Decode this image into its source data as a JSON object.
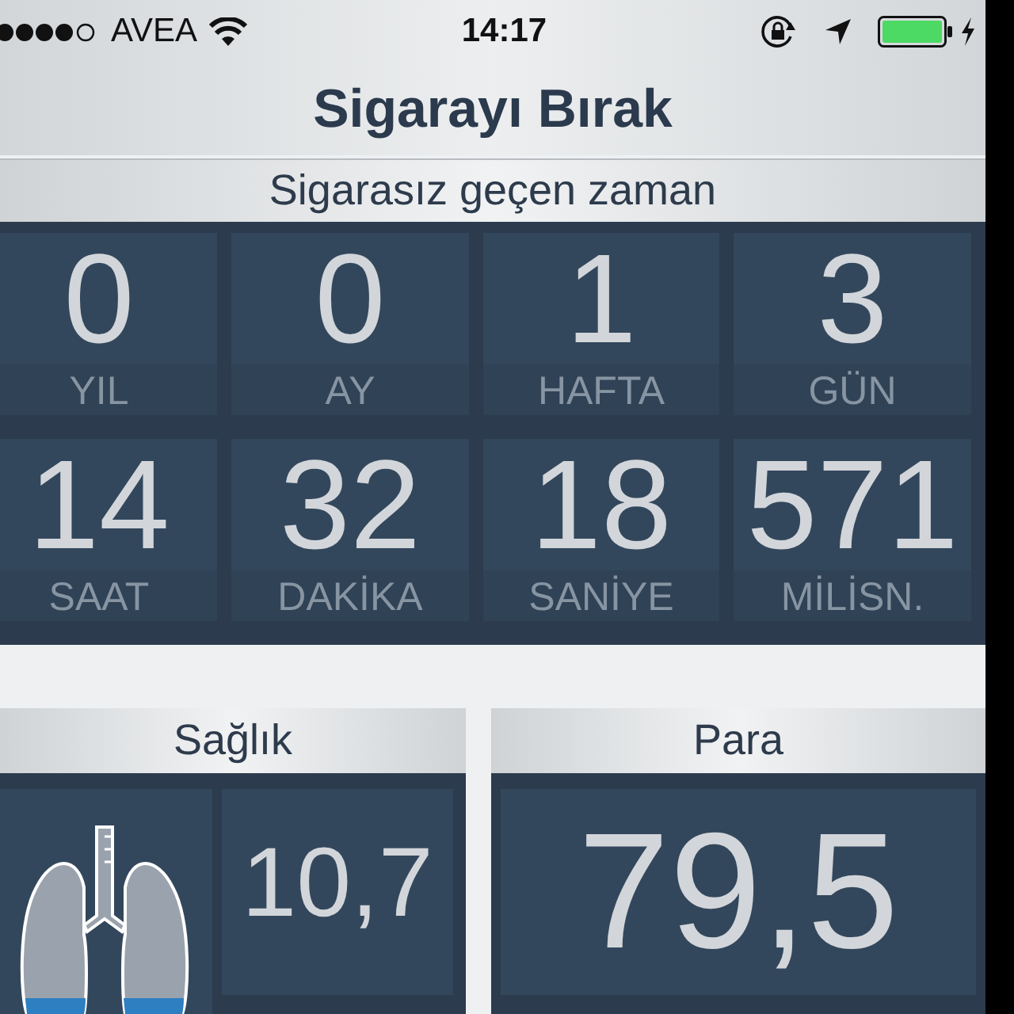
{
  "status_bar": {
    "carrier": "AVEA",
    "time": "14:17"
  },
  "title": "Sigarayı Bırak",
  "section": {
    "title": "Sigarasız geçen zaman",
    "counters": [
      {
        "value": "0",
        "unit": "YIL"
      },
      {
        "value": "0",
        "unit": "AY"
      },
      {
        "value": "1",
        "unit": "HAFTA"
      },
      {
        "value": "3",
        "unit": "GÜN"
      },
      {
        "value": "14",
        "unit": "SAAT"
      },
      {
        "value": "32",
        "unit": "DAKİKA"
      },
      {
        "value": "18",
        "unit": "SANİYE"
      },
      {
        "value": "571",
        "unit": "MİLİSN."
      }
    ]
  },
  "panels": [
    {
      "kind": "health",
      "title": "Sağlık",
      "value": "10,7"
    },
    {
      "kind": "money",
      "title": "Para",
      "value": "79,5"
    }
  ]
}
